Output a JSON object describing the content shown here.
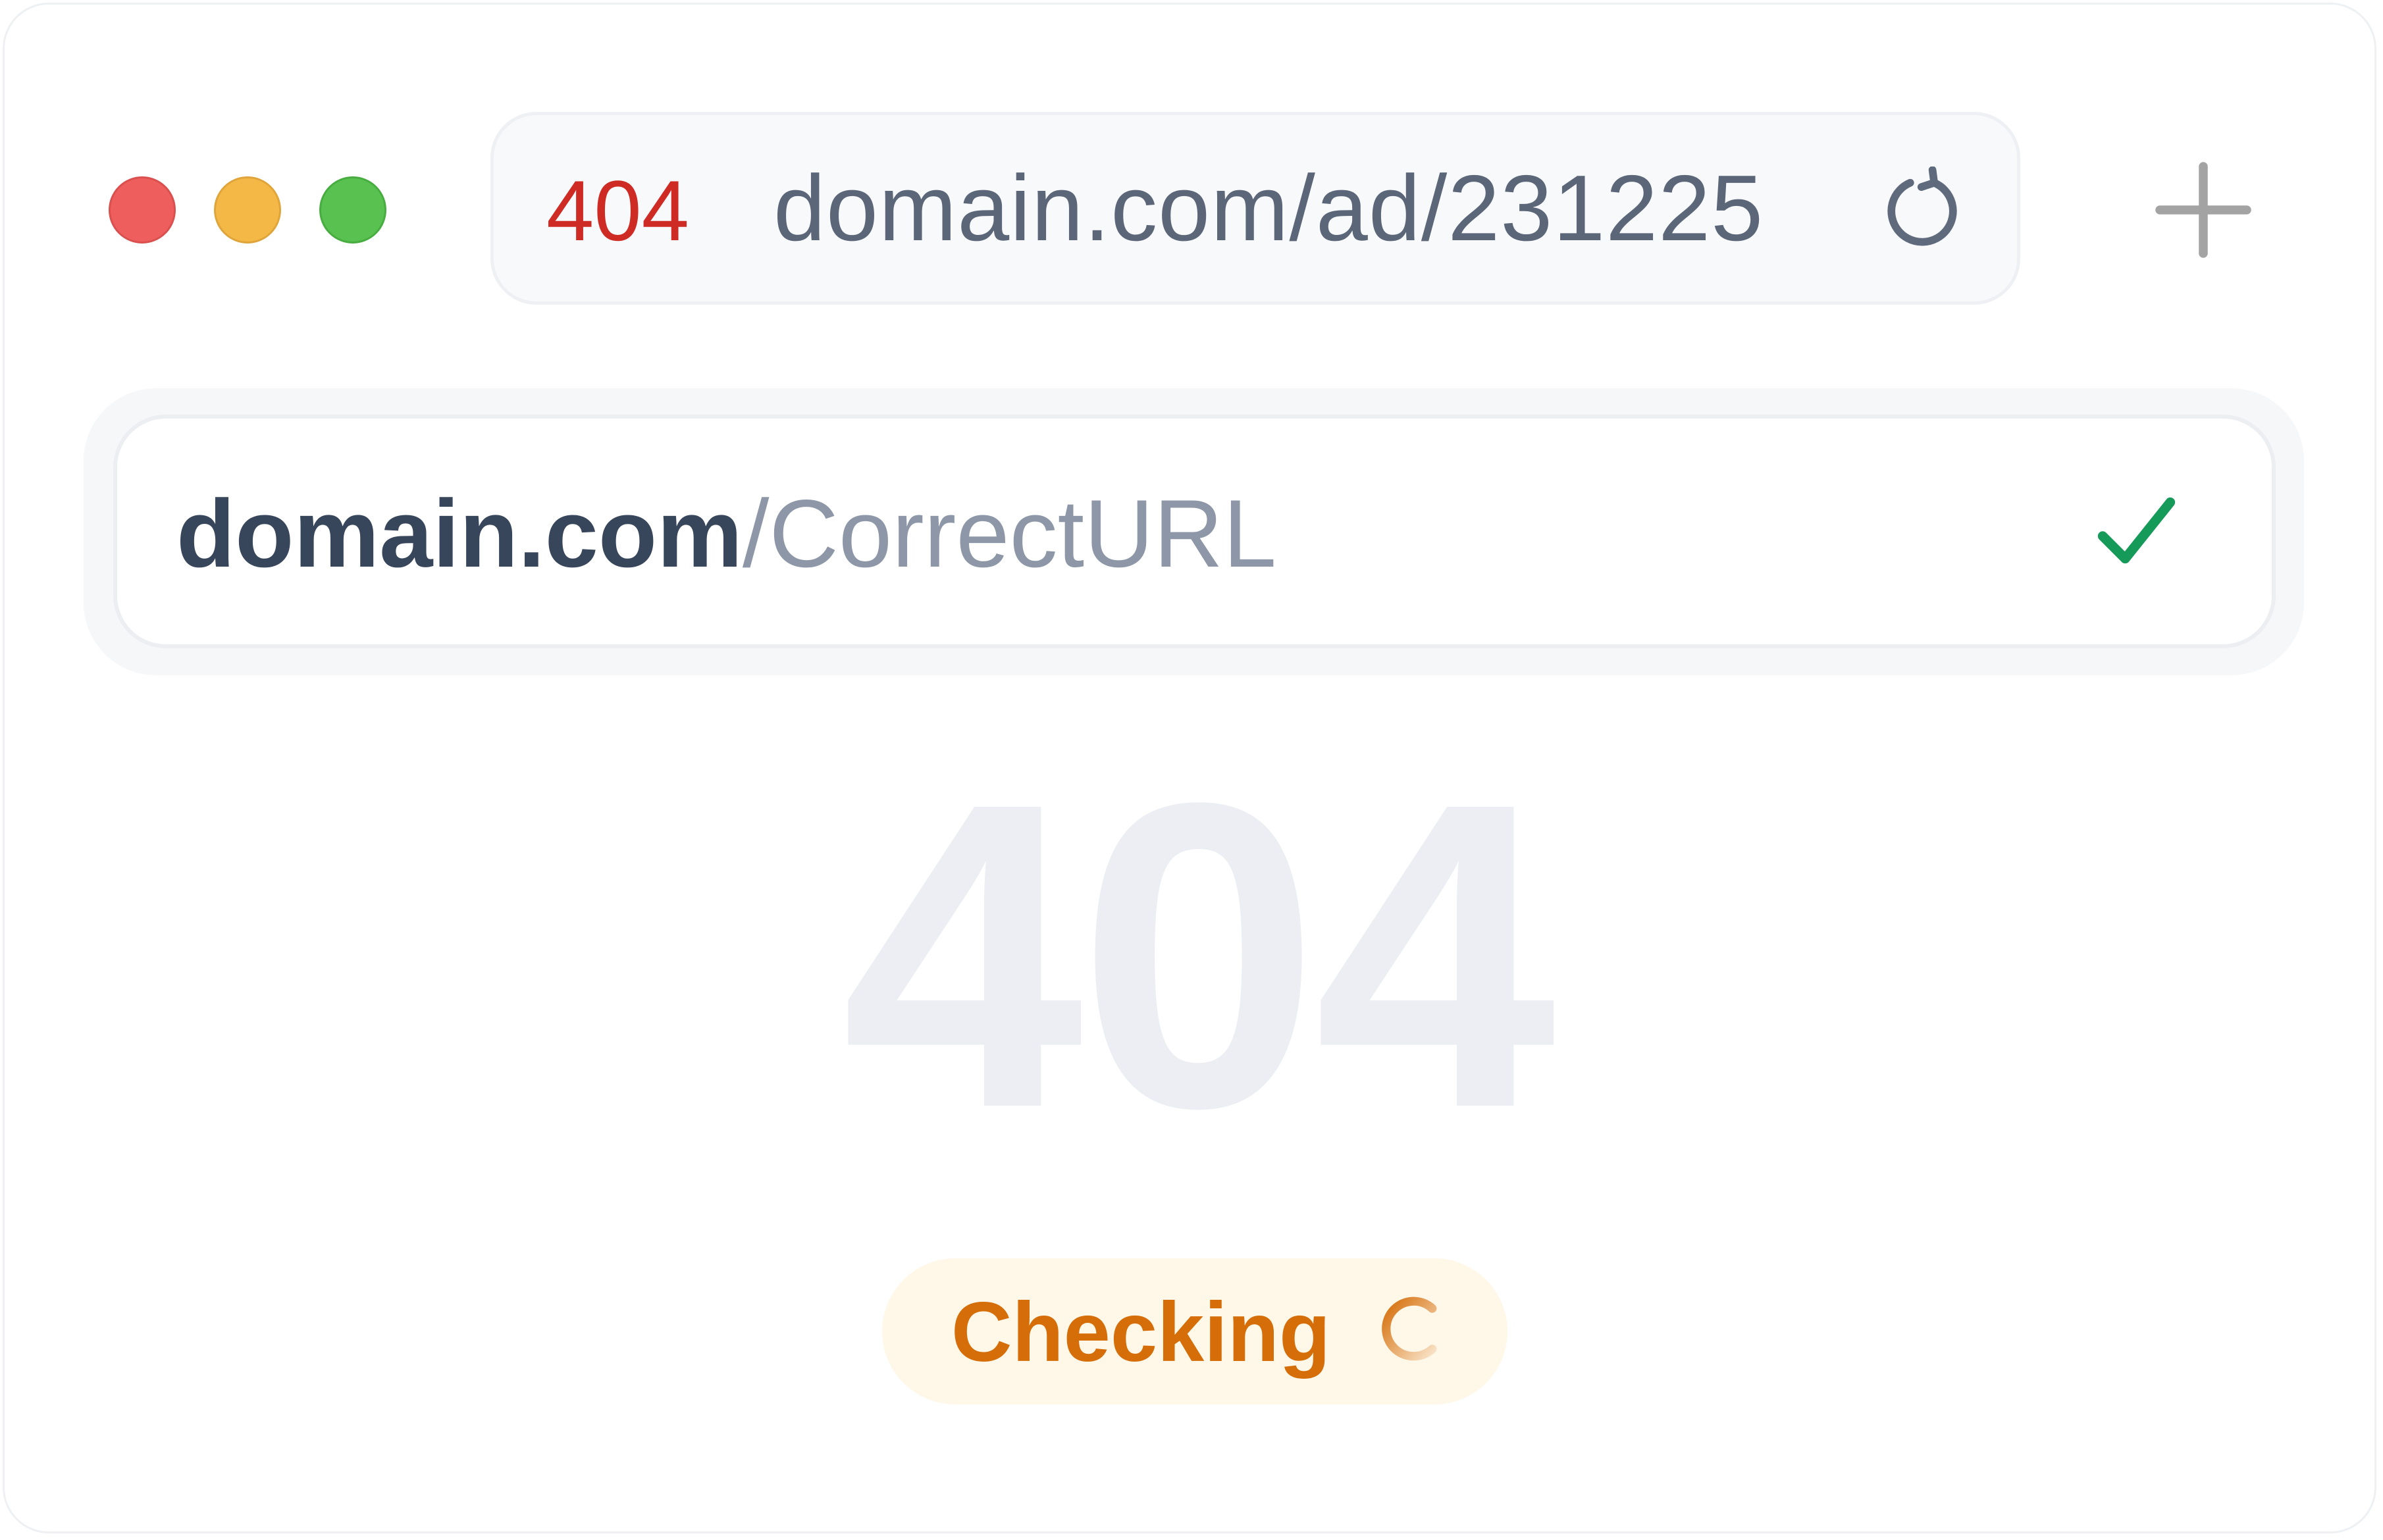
{
  "colors": {
    "window_border": "#eef0f3",
    "dot_red": "#ee5e5d",
    "dot_red_border": "#d9504f",
    "dot_yellow": "#f3b845",
    "dot_yellow_border": "#e0a53a",
    "dot_green": "#59c14f",
    "dot_green_border": "#48ad40",
    "status_error": "#cf2b25",
    "url_text": "#5b6679",
    "icon_gray": "#5f6a7c",
    "plus_gray": "#a3a3a3",
    "domain_dark": "#38465b",
    "path_gray": "#8d97a7",
    "check_green": "#159a5a",
    "big_404": "#eceef3",
    "checking_text": "#d56d08",
    "checking_bg": "#fff7e8"
  },
  "browser": {
    "window_controls": [
      "close",
      "minimize",
      "maximize"
    ],
    "address_bar": {
      "status_code": "404",
      "url": "domain.com/ad/231225",
      "reload_icon": "reload-icon"
    },
    "new_tab_icon": "plus-icon"
  },
  "suggestion": {
    "domain": "domain.com",
    "path": "/CorrectURL",
    "status_icon": "check-icon"
  },
  "error_display": {
    "code": "404"
  },
  "checking": {
    "label": "Checking",
    "icon": "spinner-icon"
  }
}
